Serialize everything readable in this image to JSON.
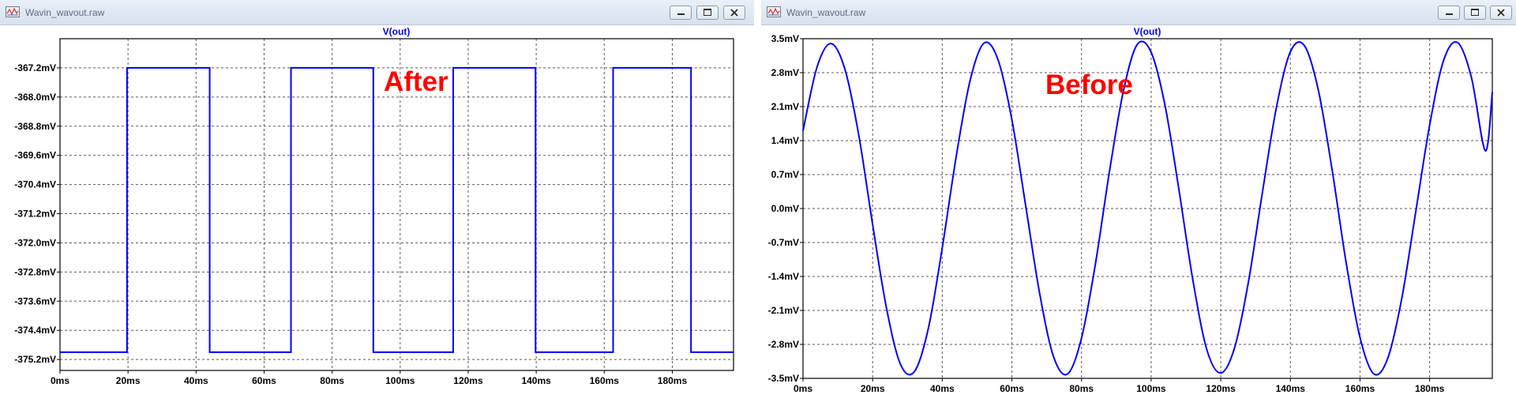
{
  "windows": {
    "left": {
      "title": "Wavin_wavout.raw"
    },
    "right": {
      "title": "Wavin_wavout.raw"
    }
  },
  "colors": {
    "trace": "#0000ff",
    "annotation": "#ff0000",
    "axis_text": "#000000",
    "title_text": "#0000ff"
  },
  "icons": [
    "waveform-app-icon",
    "minimize-icon",
    "maximize-icon",
    "close-icon"
  ],
  "chart_data": [
    {
      "type": "line",
      "title": "V(out)",
      "annotation": "After",
      "xlabel": "",
      "ylabel": "",
      "xlim": [
        0,
        198
      ],
      "ylim": [
        -375.5,
        -366.4
      ],
      "x_ticks": [
        0,
        20,
        40,
        60,
        80,
        100,
        120,
        140,
        160,
        180
      ],
      "x_tick_labels": [
        "0ms",
        "20ms",
        "40ms",
        "60ms",
        "80ms",
        "100ms",
        "120ms",
        "140ms",
        "160ms",
        "180ms"
      ],
      "y_ticks": [
        -367.2,
        -368.0,
        -368.8,
        -369.6,
        -370.4,
        -371.2,
        -372.0,
        -372.8,
        -373.6,
        -374.4,
        -375.2
      ],
      "y_tick_labels": [
        "-367.2mV",
        "-368.0mV",
        "-368.8mV",
        "-369.6mV",
        "-370.4mV",
        "-371.2mV",
        "-372.0mV",
        "-372.8mV",
        "-373.6mV",
        "-374.4mV",
        "-375.2mV"
      ],
      "grid": true,
      "series": [
        {
          "x": [
            0,
            19.7,
            19.7,
            44.0,
            44.0,
            67.9,
            67.9,
            92.1,
            92.1,
            115.6,
            115.6,
            139.8,
            139.8,
            162.6,
            162.6,
            185.5,
            185.5,
            198
          ],
          "y": [
            -375.0,
            -375.0,
            -367.2,
            -367.2,
            -375.0,
            -375.0,
            -367.2,
            -367.2,
            -375.0,
            -375.0,
            -367.2,
            -367.2,
            -375.0,
            -375.0,
            -367.2,
            -367.2,
            -375.0,
            -375.0
          ]
        }
      ]
    },
    {
      "type": "line",
      "title": "V(out)",
      "annotation": "Before",
      "xlabel": "",
      "ylabel": "",
      "xlim": [
        0,
        198
      ],
      "ylim": [
        -3.5,
        3.5
      ],
      "x_ticks": [
        0,
        20,
        40,
        60,
        80,
        100,
        120,
        140,
        160,
        180
      ],
      "x_tick_labels": [
        "0ms",
        "20ms",
        "40ms",
        "60ms",
        "80ms",
        "100ms",
        "120ms",
        "140ms",
        "160ms",
        "180ms"
      ],
      "y_ticks": [
        3.5,
        2.8,
        2.1,
        1.4,
        0.7,
        0.0,
        -0.7,
        -1.4,
        -2.1,
        -2.8,
        -3.5
      ],
      "y_tick_labels": [
        "3.5mV",
        "2.8mV",
        "2.1mV",
        "1.4mV",
        "0.7mV",
        "0.0mV",
        "-0.7mV",
        "-1.4mV",
        "-2.1mV",
        "-2.8mV",
        "-3.5mV"
      ],
      "grid": true,
      "series": [
        {
          "x": [
            0,
            4,
            8,
            12,
            16,
            20,
            24,
            28,
            32,
            36,
            40,
            44,
            48,
            52,
            56,
            60,
            64,
            68,
            72,
            76,
            80,
            84,
            88,
            92,
            96,
            100,
            104,
            108,
            112,
            116,
            120,
            124,
            128,
            132,
            136,
            140,
            144,
            148,
            152,
            156,
            160,
            164,
            168,
            172,
            176,
            180,
            184,
            188,
            192,
            196,
            198
          ],
          "y": [
            1.6,
            2.91,
            3.4,
            2.88,
            1.52,
            -0.33,
            -2.06,
            -3.21,
            -3.36,
            -2.47,
            -0.81,
            1.07,
            2.64,
            3.41,
            3.07,
            1.83,
            0.04,
            -1.76,
            -3.06,
            -3.41,
            -2.67,
            -1.14,
            0.75,
            2.41,
            3.38,
            3.22,
            2.12,
            0.38,
            -1.48,
            -2.91,
            -3.39,
            -2.86,
            -1.49,
            0.35,
            2.09,
            3.23,
            3.36,
            2.45,
            0.79,
            -1.11,
            -2.66,
            -3.41,
            -3.08,
            -1.85,
            -0.07,
            1.72,
            3.05,
            3.42,
            2.7,
            1.19,
            2.4
          ]
        }
      ]
    }
  ]
}
